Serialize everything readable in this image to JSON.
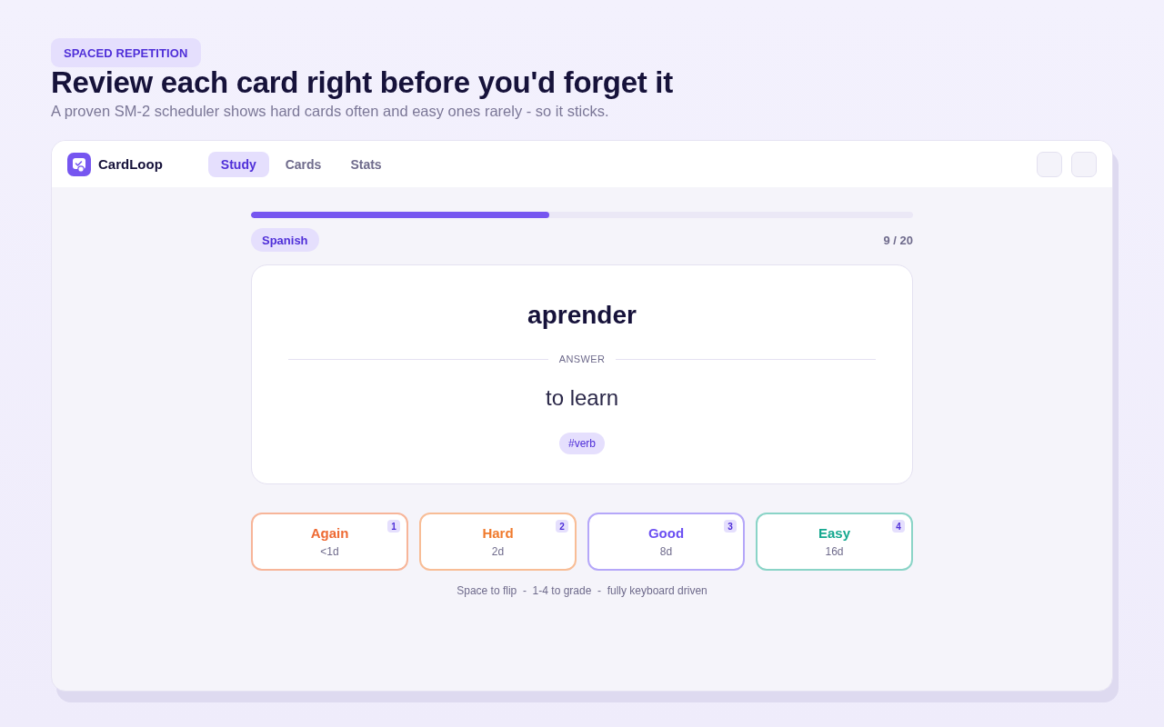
{
  "hero": {
    "eyebrow": "SPACED REPETITION",
    "title": "Review each card right before you'd forget it",
    "subtitle": "A proven SM-2 scheduler shows hard cards often and easy ones rarely - so it sticks."
  },
  "app": {
    "name": "CardLoop",
    "tabs": [
      {
        "label": "Study",
        "selected": true
      },
      {
        "label": "Cards",
        "selected": false
      },
      {
        "label": "Stats",
        "selected": false
      }
    ]
  },
  "session": {
    "progress": {
      "level": 0.45
    },
    "deck": "Spanish",
    "counter": "9 / 20"
  },
  "card": {
    "front": "aprender",
    "divider_label": "ANSWER",
    "back": "to learn",
    "tags": [
      "#verb"
    ]
  },
  "grades": [
    {
      "label": "Again",
      "interval": "<1d",
      "key": "1",
      "color": "#ee6a33"
    },
    {
      "label": "Hard",
      "interval": "2d",
      "key": "2",
      "color": "#f07a2c"
    },
    {
      "label": "Good",
      "interval": "8d",
      "key": "3",
      "color": "#6b4ff2"
    },
    {
      "label": "Easy",
      "interval": "16d",
      "key": "4",
      "color": "#14a88f"
    }
  ],
  "hint": "Space to flip  -  1-4 to grade  -  fully keyboard driven"
}
